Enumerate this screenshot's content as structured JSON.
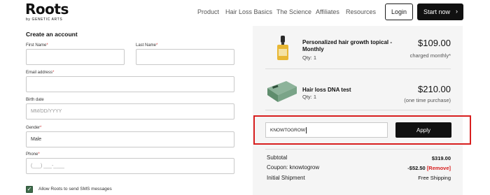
{
  "header": {
    "logo": "Roots",
    "logo_sub": "by  GENETIC ARTS",
    "nav": [
      "Product",
      "Hair Loss Basics",
      "The Science",
      "Affiliates",
      "Resources"
    ],
    "login_label": "Login",
    "start_label": "Start now",
    "start_arrow": "›"
  },
  "form": {
    "title": "Create an account",
    "required_mark": "*",
    "first_name_label": "First Name",
    "last_name_label": "Last Name",
    "email_label": "Email address",
    "birth_label": "Birth date",
    "birth_placeholder": "MM/DD/YYYY",
    "gender_label": "Gender",
    "gender_value": "Male",
    "phone_label": "Phone",
    "phone_placeholder": "(___) ___-____",
    "sms_label": "Allow Roots to send SMS messages",
    "sms_checked": true
  },
  "order": {
    "items": [
      {
        "name_line1": "Personalized hair growth topical -",
        "name_line2": "Monthly",
        "qty": "Qty: 1",
        "price": "$109.00",
        "note": "charged monthly*",
        "image_icon": "dropper-bottle-icon"
      },
      {
        "name_line1": "Hair loss DNA test",
        "name_line2": "",
        "qty": "Qty: 1",
        "price": "$210.00",
        "note": "(one time purchase)",
        "image_icon": "dna-kit-box-icon"
      }
    ],
    "coupon_value": "KNOWTOGROW",
    "apply_label": "Apply",
    "subtotal_label": "Subtotal",
    "subtotal_value": "$319.00",
    "coupon_label": "Coupon: knowtogrow",
    "coupon_discount": "-$52.50",
    "remove_label": "[Remove]",
    "shipping_label": "Initial Shipment",
    "shipping_value": "Free Shipping"
  },
  "colors": {
    "accent_dark": "#111111",
    "highlight_red": "#d81f1f",
    "checkbox_green": "#3e6b4a",
    "panel_bg": "#f5f5f5",
    "required_red": "#d23a3a"
  }
}
